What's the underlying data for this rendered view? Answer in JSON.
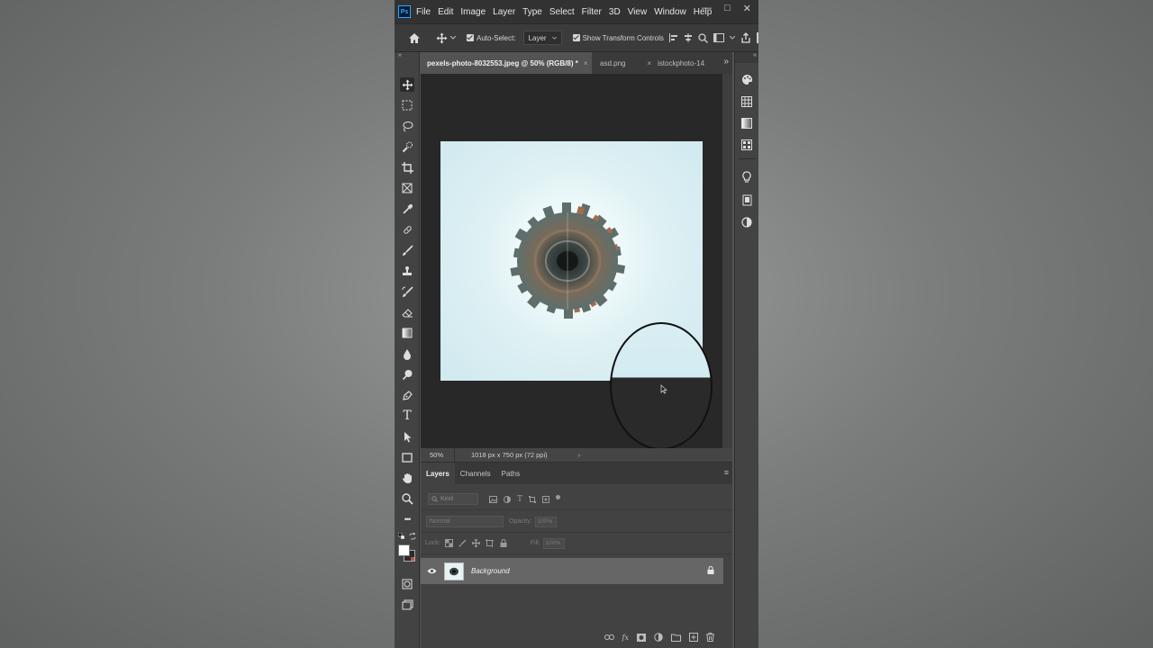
{
  "app": {
    "logo_text": "Ps",
    "accent": "#31a8ff"
  },
  "menu": [
    "File",
    "Edit",
    "Image",
    "Layer",
    "Type",
    "Select",
    "Filter",
    "3D",
    "View",
    "Window",
    "Help"
  ],
  "window_controls": {
    "minimize": "—",
    "restore": "□",
    "close": "✕"
  },
  "options": {
    "auto_select_label": "Auto-Select:",
    "auto_select_value": "Layer",
    "show_transform_label": "Show Transform Controls"
  },
  "tabs": [
    {
      "label": "pexels-photo-8032553.jpeg @ 50% (RGB/8) *",
      "active": true
    },
    {
      "label": "asd.png",
      "active": false
    },
    {
      "label": "istockphoto-14",
      "active": false
    }
  ],
  "tabs_overflow": "»",
  "status": {
    "zoom": "50%",
    "doc_info": "1018 px x 750 px (72 ppi)",
    "arrow": "›"
  },
  "layers_panel": {
    "tabs": [
      "Layers",
      "Channels",
      "Paths"
    ],
    "menu_icon": "≡",
    "kind_placeholder": "Kind",
    "blend_mode": "Normal",
    "opacity_label": "Opacity:",
    "opacity_value": "100%",
    "lock_label": "Lock:",
    "fill_label": "Fill:",
    "fill_value": "100%",
    "layer_name": "Background",
    "footer_icons": [
      "link-icon",
      "fx-icon",
      "mask-icon",
      "adjustment-icon",
      "group-icon",
      "new-layer-icon",
      "trash-icon"
    ],
    "fx_text": "fx"
  },
  "toolbar_icons": [
    "move",
    "marquee",
    "lasso",
    "quick-select",
    "crop",
    "frame",
    "eyedropper",
    "healing",
    "brush",
    "stamp",
    "history-brush",
    "eraser",
    "gradient",
    "blur",
    "dodge",
    "pen",
    "type",
    "path-select",
    "rectangle",
    "hand",
    "zoom",
    "more",
    "swap-colors",
    "quick-mask",
    "screen-mode"
  ],
  "more_tools_text": "•••",
  "type_tool_text": "T",
  "right_panel_icons": [
    "color-icon",
    "swatches-icon",
    "gradients-icon",
    "patterns-icon",
    "lightbulb-icon",
    "libraries-icon",
    "adjustments-icon"
  ]
}
